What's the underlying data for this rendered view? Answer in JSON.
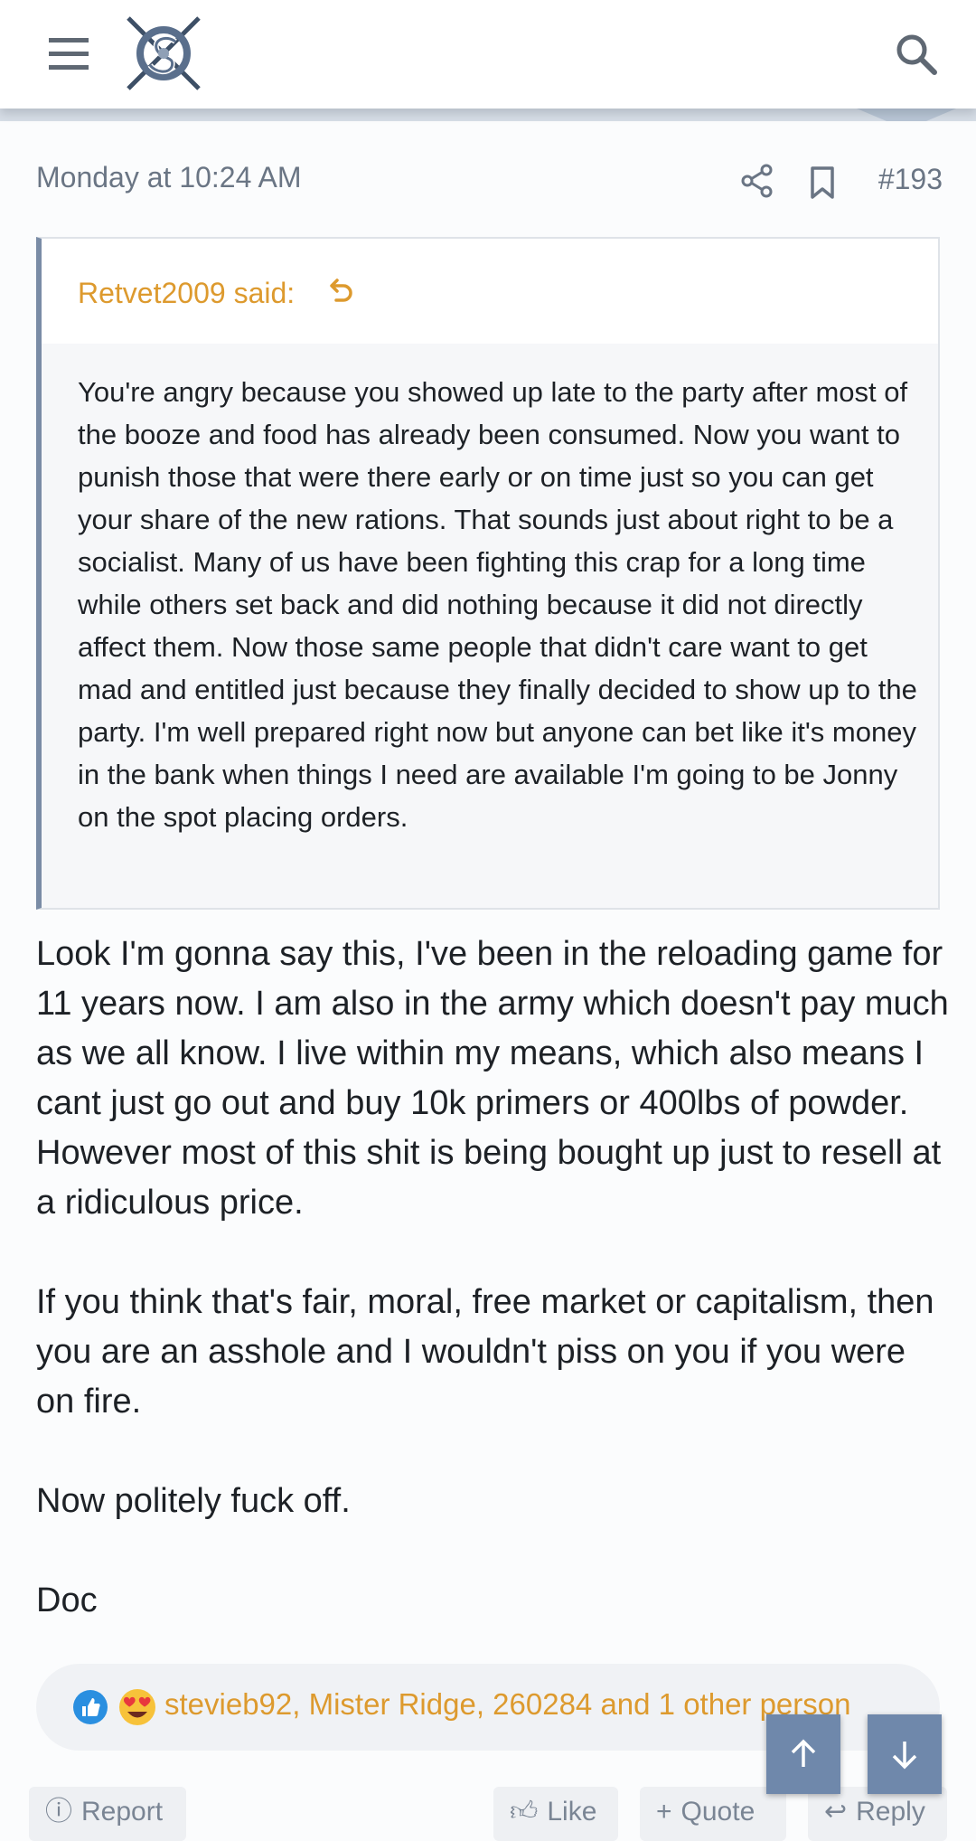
{
  "header": {
    "menu_icon": "hamburger-menu-icon",
    "logo": "site-logo",
    "search_icon": "search-icon"
  },
  "post": {
    "date": "Monday at 10:24 AM",
    "number": "#193",
    "share_icon": "share-icon",
    "bookmark_icon": "bookmark-icon",
    "quote": {
      "author_label": "Retvet2009 said:",
      "text": "You're angry because you showed up late to the party after most of the booze and food has already been consumed. Now you want to punish those that were there early or on time just so you can get your share of the new rations. That sounds just about right to be a socialist. Many of us have been fighting this crap for a long time while others set back and did nothing because it did not directly affect them. Now those same people that didn't care want to get mad and entitled just because they finally decided to show up to the party. I'm well prepared right now but anyone can bet like it's money in the bank when things I need are available I'm going to be Jonny on the spot placing orders."
    },
    "paragraphs": [
      "Look I'm gonna say this, I've been in the reloading game for 11 years now. I am also in the army which doesn't pay much as we all know. I live within my means, which also means I cant just go out and buy 10k primers or 400lbs of powder. However most of this shit is being bought up just to resell at a ridiculous price.",
      "If you think that's fair, moral, free market or capitalism, then you are an asshole and I wouldn't piss on you if you were on fire.",
      "Now politely fuck off.",
      "Doc"
    ],
    "reactions": {
      "icons": [
        "like-reaction-icon",
        "love-reaction-icon"
      ],
      "text": "stevieb92, Mister Ridge, 260284 and 1 other person"
    },
    "actions": {
      "report": "Report",
      "like": "Like",
      "quote": "Quote",
      "reply": "Reply"
    }
  },
  "scroll": {
    "up_icon": "arrow-up-icon",
    "down_icon": "arrow-down-icon"
  },
  "colors": {
    "accent": "#dd9a2e",
    "quote_border": "#7a8ca6",
    "fab": "#6f88ab",
    "muted_text": "#6a7584"
  }
}
